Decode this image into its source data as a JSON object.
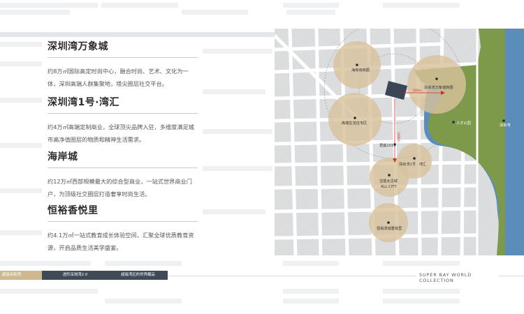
{
  "venues": [
    {
      "title": "深圳湾万象城",
      "desc": "约8万㎡国际高定时尚中心，融合时尚、艺术、文化为一体，深圳高端人群集聚地，塔尖圈层社交平台。"
    },
    {
      "title": "深圳湾1号·湾汇",
      "desc": "约4万㎡高端定制商业，全球顶尖品牌入驻，多维度满足城市高净值圈层的物质和精神生活需求。"
    },
    {
      "title": "海岸城",
      "desc": "约12万㎡西部规模最大的综合型商业，一站式世界商业门户，为顶级社交圈层打造奢享时尚生活。"
    },
    {
      "title": "恒裕香悦里",
      "desc": "约4.1万㎡一站式教育成长体验空间，汇聚全球优质教育资源，开启品质生活美学盛宴。"
    }
  ],
  "map": {
    "labels": {
      "haian": "海岸城商圈",
      "wanxiang": "深圳湾万象城商圈",
      "gaoduan": "高端生活住宅区",
      "rencai": "人才公园",
      "shenzhenwan": "深圳湾",
      "project": "君庭1019",
      "bay1": "深圳湾1号 · 湾汇",
      "baoneng": "宝能太古城",
      "allcity": "ALL CITY",
      "hengyu": "恒裕滨城香悦里",
      "dist1": "500m",
      "dist2": "1000m"
    },
    "colors": {
      "water": "#5b8dbb",
      "green": "#7d9a4a",
      "circle": "#d8c29c",
      "project": "#3b4654",
      "arrow": "#c8322c"
    }
  },
  "bottom": {
    "tab1": "超级深圳湾",
    "tab2": "进阶深圳湾2.0",
    "tab3": "超级湾区的世界藏品",
    "collection": "SUPER BAY WORLD COLLECTION"
  }
}
